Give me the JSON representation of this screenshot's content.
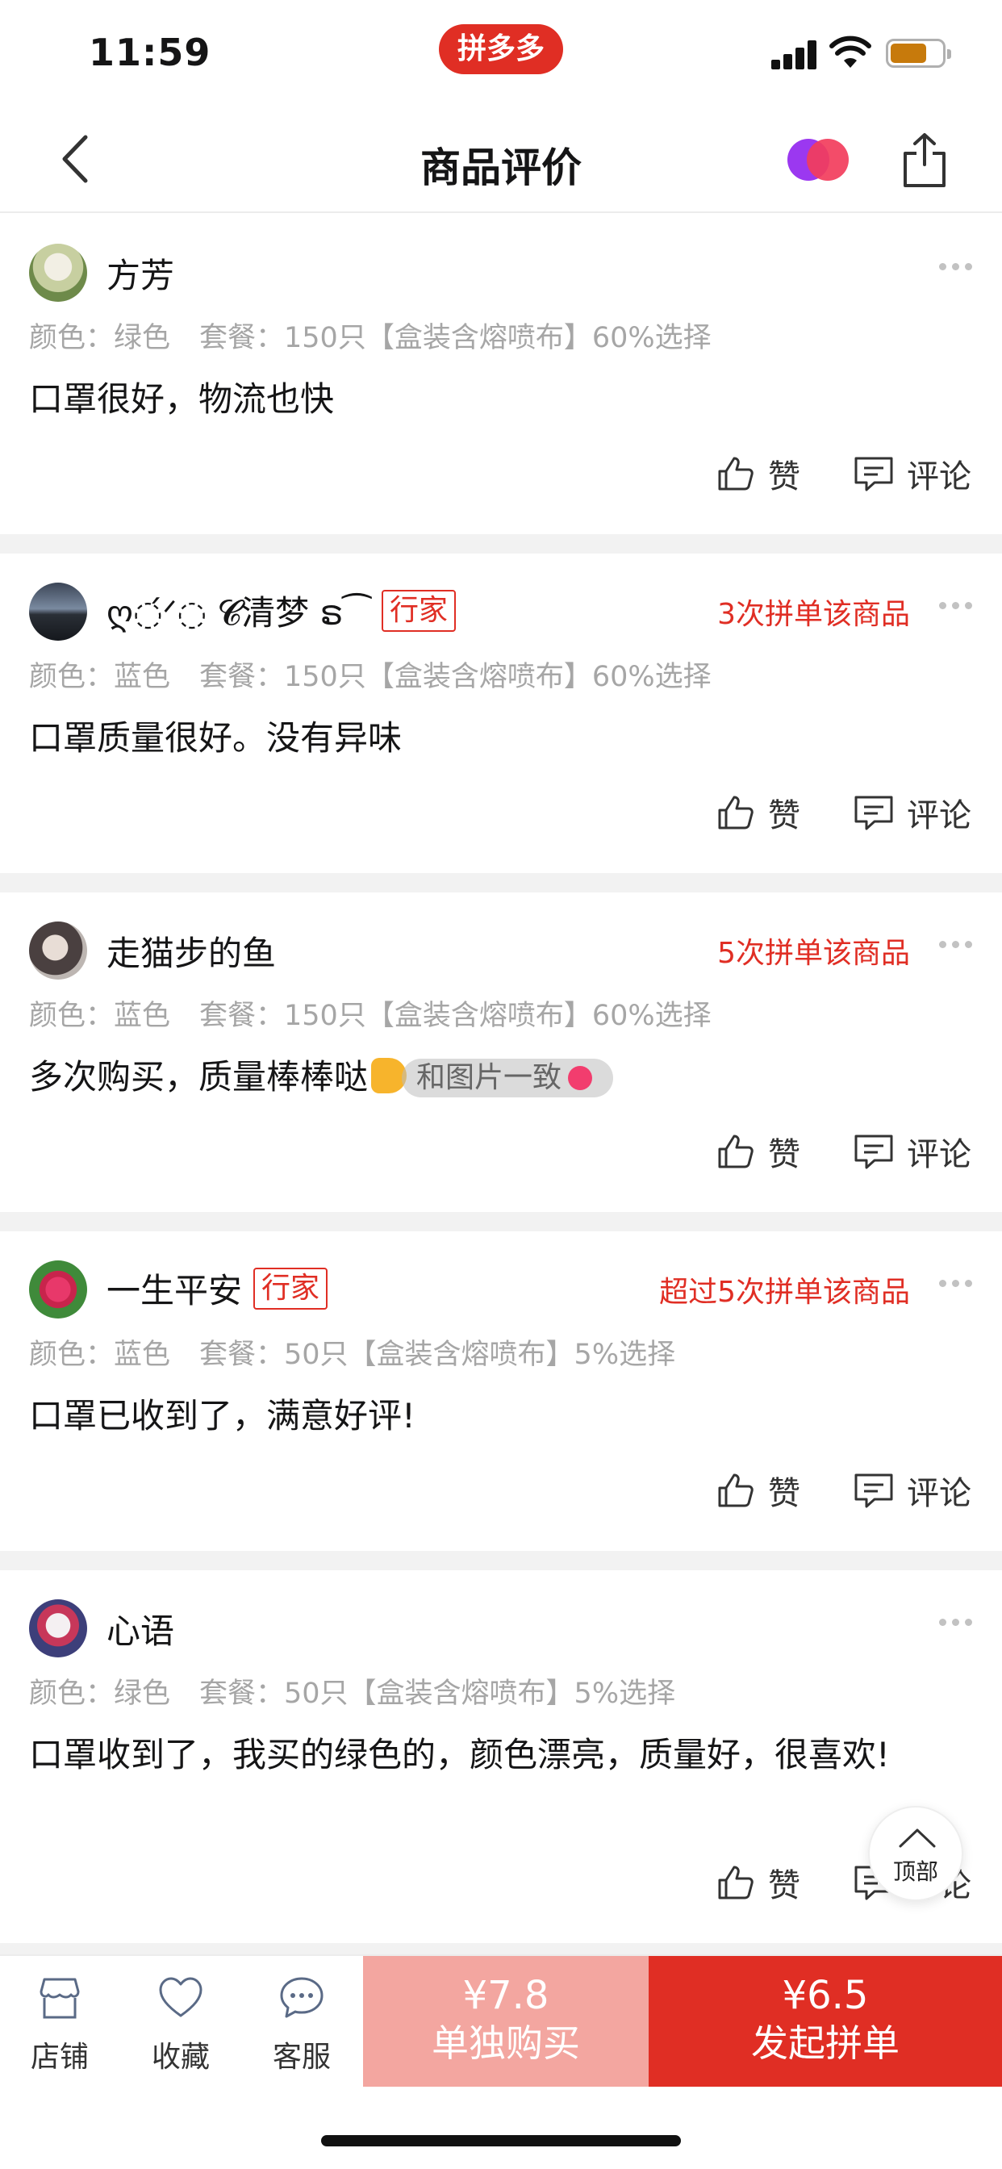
{
  "status_bar": {
    "time": "11:59",
    "app_badge": "拼多多"
  },
  "navbar": {
    "title": "商品评价"
  },
  "reviews": [
    {
      "username": "方芳",
      "tag": "",
      "buy_count": "",
      "spec_color": "颜色：绿色",
      "spec_package": "套餐：150只【盒装含熔喷布】60%选择",
      "comment": "口罩很好，物流也快",
      "like_label": "赞",
      "comment_label": "评论"
    },
    {
      "username": "ღ◌́ᐟ◌ 𝓒清梦 ຣ⁀",
      "tag": "行家",
      "buy_count": "3次拼单该商品",
      "spec_color": "颜色：蓝色",
      "spec_package": "套餐：150只【盒装含熔喷布】60%选择",
      "comment": "口罩质量很好。没有异味",
      "like_label": "赞",
      "comment_label": "评论"
    },
    {
      "username": "走猫步的鱼",
      "tag": "",
      "buy_count": "5次拼单该商品",
      "spec_color": "颜色：蓝色",
      "spec_package": "套餐：150只【盒装含熔喷布】60%选择",
      "comment": "多次购买，质量棒棒哒",
      "image_chip_label": "和图片一致",
      "like_label": "赞",
      "comment_label": "评论"
    },
    {
      "username": "一生平安",
      "tag": "行家",
      "buy_count": "超过5次拼单该商品",
      "spec_color": "颜色：蓝色",
      "spec_package": "套餐：50只【盒装含熔喷布】5%选择",
      "comment": "口罩已收到了，满意好评!",
      "like_label": "赞",
      "comment_label": "评论"
    },
    {
      "username": "心语",
      "tag": "",
      "buy_count": "",
      "spec_color": "颜色：绿色",
      "spec_package": "套餐：50只【盒装含熔喷布】5%选择",
      "comment": "口罩收到了，我买的绿色的，颜色漂亮，质量好，很喜欢!",
      "like_label": "赞",
      "comment_label": "评论"
    }
  ],
  "top_button": {
    "label": "顶部"
  },
  "bottom_bar": {
    "shop_label": "店铺",
    "favorite_label": "收藏",
    "service_label": "客服",
    "single_price": "¥7.8",
    "single_label": "单独购买",
    "group_price": "¥6.5",
    "group_label": "发起拼单"
  },
  "colors": {
    "brand_red": "#e02e24",
    "light_red": "#f3a6a0",
    "spec_gray": "#a6a6a6",
    "divider": "#f2f2f2"
  },
  "icons": [
    "back-arrow-icon",
    "brand-dots-icon",
    "share-icon",
    "more-icon",
    "thumb-up-icon",
    "comment-icon",
    "top-arrow-icon",
    "shop-icon",
    "heart-icon",
    "chat-icon"
  ]
}
